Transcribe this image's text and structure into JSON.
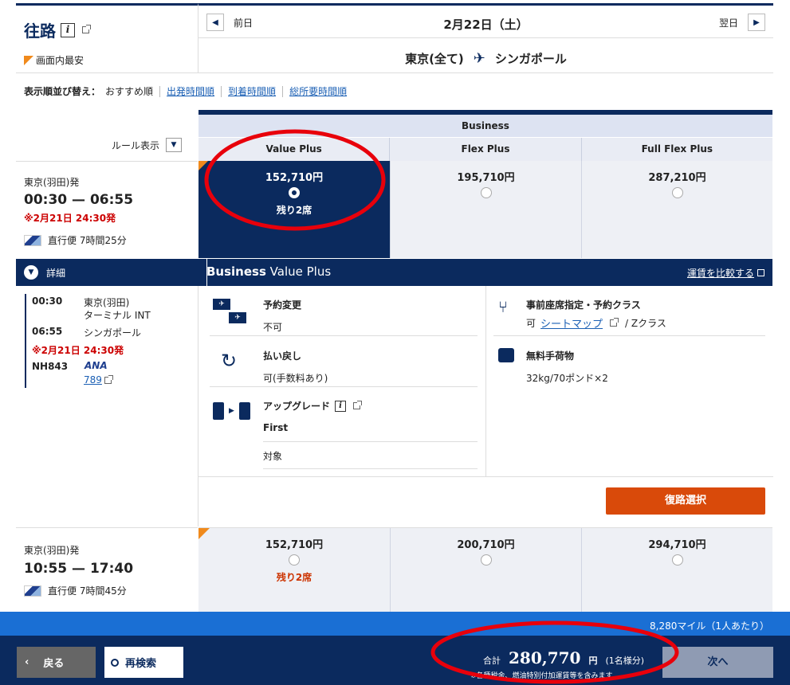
{
  "header": {
    "title": "往路",
    "legend": "画面内最安",
    "prev_day": "前日",
    "next_day": "翌日",
    "date": "2月22日（土）",
    "origin": "東京(全て)",
    "destination": "シンガポール"
  },
  "sort": {
    "label": "表示順並び替え：",
    "options": [
      "おすすめ順",
      "出発時間順",
      "到着時間順",
      "総所要時間順"
    ]
  },
  "rules_label": "ルール表示",
  "cabin": "Business",
  "fare_columns": [
    "Value Plus",
    "Flex Plus",
    "Full Flex Plus"
  ],
  "flight1": {
    "origin": "東京(羽田)発",
    "times": "00:30 — 06:55",
    "note": "※2月21日 24:30発",
    "direct": "直行便 7時間25分",
    "prices": [
      "152,710円",
      "195,710円",
      "287,210円"
    ],
    "seats_left": "残り2席"
  },
  "details": {
    "toggle_label": "詳細",
    "dep_time": "00:30",
    "dep_place": "東京(羽田)",
    "dep_terminal": "ターミナル INT",
    "arr_time": "06:55",
    "arr_place": "シンガポール",
    "note": "※2月21日 24:30発",
    "flight_no": "NH843",
    "airline": "ANA",
    "aircraft": "789"
  },
  "fare_panel": {
    "title_bold": "Business",
    "title_rest": " Value Plus",
    "compare_link": "運賃を比較する",
    "change_label": "予約変更",
    "change_val": "不可",
    "refund_label": "払い戻し",
    "refund_val": "可(手数料あり)",
    "upgrade_label": "アップグレード",
    "upgrade_class": "First",
    "upgrade_val": "対象",
    "seat_label": "事前座席指定・予約クラス",
    "seat_val_prefix": "可",
    "seat_map_link": "シートマップ",
    "seat_val_suffix": "/ Zクラス",
    "baggage_label": "無料手荷物",
    "baggage_val": "32kg/70ポンド×2",
    "return_button": "復路選択"
  },
  "flight2": {
    "origin": "東京(羽田)発",
    "times": "10:55 — 17:40",
    "direct": "直行便 7時間45分",
    "prices": [
      "152,710円",
      "200,710円",
      "294,710円"
    ],
    "seats_left": "残り2席"
  },
  "footer": {
    "miles": "8,280マイル（1人あたり）",
    "back": "戻る",
    "research": "再検索",
    "total_label": "合計",
    "total_amount": "280,770",
    "total_unit": "円",
    "per_person": "(1名様分)",
    "tax_note": "※各種税金、燃油特別付加運賃等を含みます",
    "next": "次へ"
  },
  "colors": {
    "navy": "#0b2a5e",
    "accent_orange": "#d94a0a",
    "price_red": "#cc0000",
    "highlight_circle": "#e8000b"
  }
}
